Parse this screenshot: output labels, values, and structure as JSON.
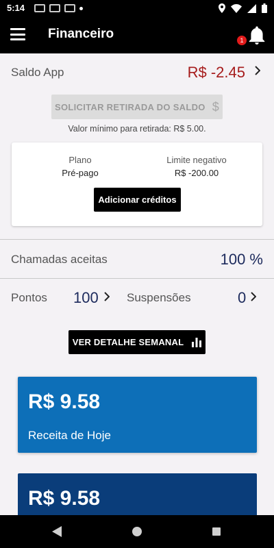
{
  "status_bar": {
    "time": "5:14"
  },
  "app_bar": {
    "title": "Financeiro",
    "notification_count": "1"
  },
  "saldo": {
    "label": "Saldo App",
    "value": "R$ -2.45"
  },
  "withdraw": {
    "label": "SOLICITAR RETIRADA DO SALDO",
    "icon": "$",
    "min_note": "Valor mínimo para retirada: R$ 5.00."
  },
  "plan": {
    "plan_label": "Plano",
    "plan_value": "Pré-pago",
    "limit_label": "Limite negativo",
    "limit_value": "R$ -200.00",
    "add_credits_label": "Adicionar créditos"
  },
  "calls": {
    "label": "Chamadas aceitas",
    "value": "100 %"
  },
  "points": {
    "label": "Pontos",
    "value": "100"
  },
  "suspensions": {
    "label": "Suspensões",
    "value": "0"
  },
  "weekly_button": {
    "label": "VER DETALHE SEMANAL"
  },
  "cards": {
    "today": {
      "amount": "R$ 9.58",
      "label": "Receita de Hoje",
      "color": "#0d6fb8"
    },
    "week": {
      "amount": "R$ 9.58",
      "color": "#0a3d7a"
    }
  },
  "colors": {
    "negative": "#a61c1c",
    "value_blue": "#1c2a5c"
  }
}
